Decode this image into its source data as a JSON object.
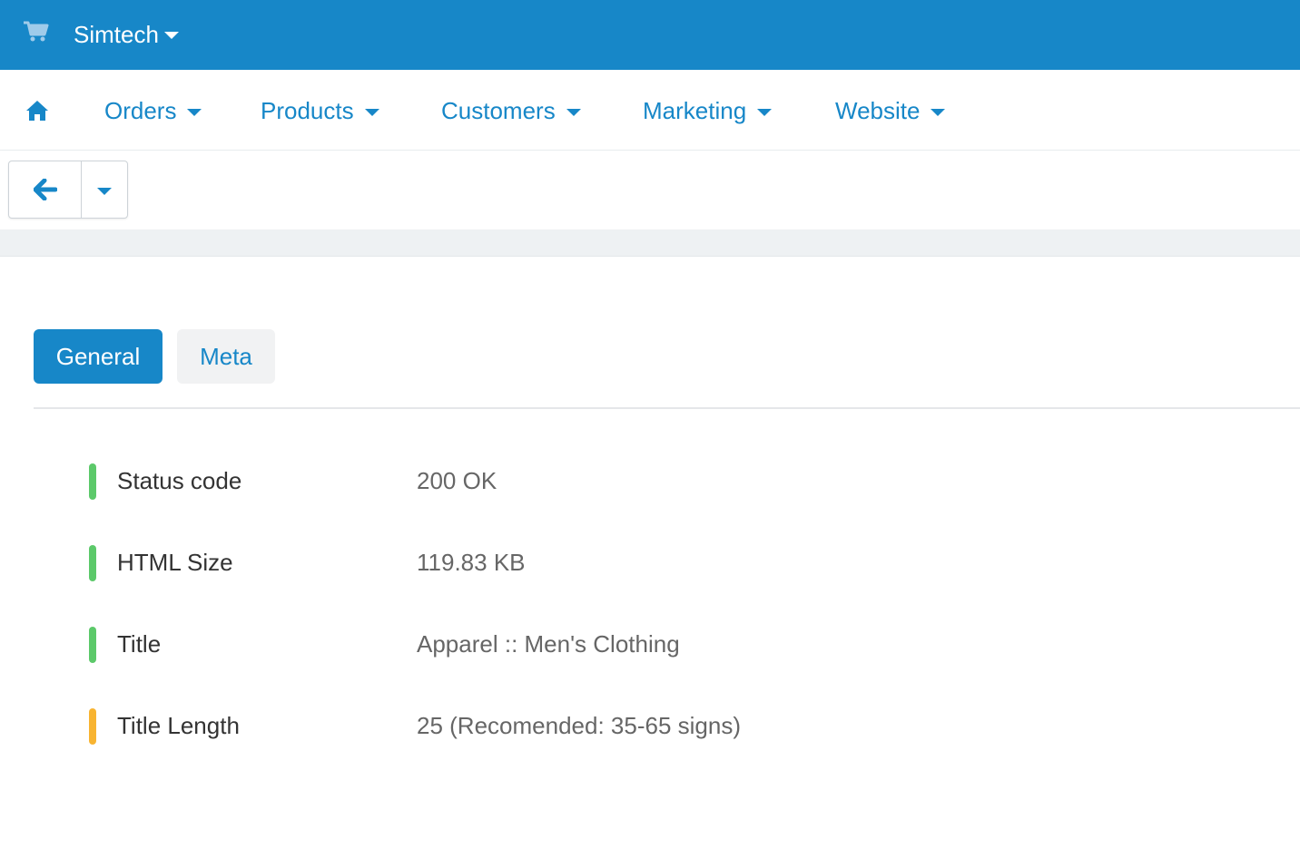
{
  "header": {
    "store_name": "Simtech",
    "brand_color": "#1787c8",
    "cart_icon": "cart-icon"
  },
  "nav": {
    "home_icon": "home-icon",
    "items": [
      {
        "label": "Orders"
      },
      {
        "label": "Products"
      },
      {
        "label": "Customers"
      },
      {
        "label": "Marketing"
      },
      {
        "label": "Website"
      }
    ]
  },
  "toolbar": {
    "back_icon": "arrow-left-icon",
    "dropdown_icon": "chevron-down-icon"
  },
  "tabs": [
    {
      "label": "General",
      "active": true
    },
    {
      "label": "Meta",
      "active": false
    }
  ],
  "seo_checks": [
    {
      "label": "Status code",
      "value": "200 OK",
      "status": "ok",
      "color": "#5cc96a"
    },
    {
      "label": "HTML Size",
      "value": "119.83 KB",
      "status": "ok",
      "color": "#5cc96a"
    },
    {
      "label": "Title",
      "value": "Apparel :: Men's Clothing",
      "status": "ok",
      "color": "#5cc96a"
    },
    {
      "label": "Title Length",
      "value": "25 (Recomended: 35-65 signs)",
      "status": "warning",
      "color": "#f8b431"
    }
  ]
}
